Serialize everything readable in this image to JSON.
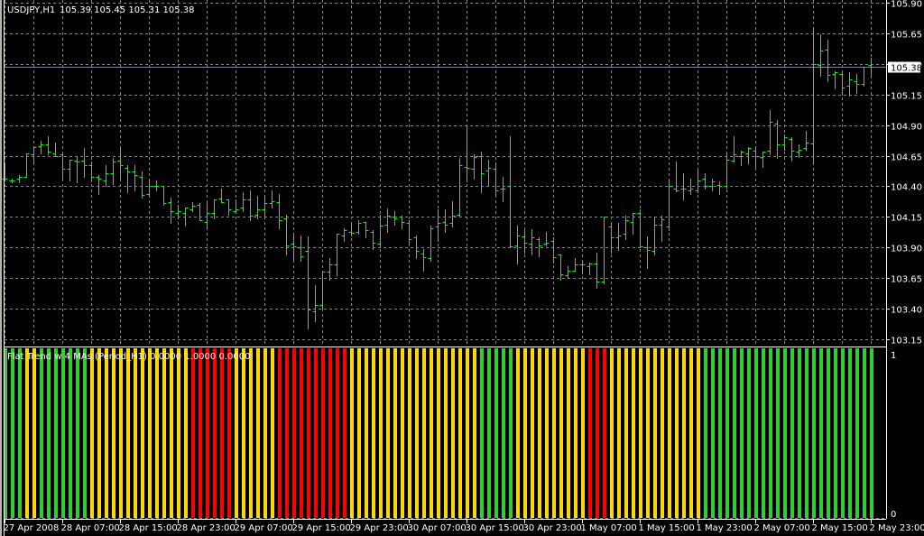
{
  "header": {
    "symbol": "USDJPY,H1",
    "ohlc": "105.39 105.45 105.31 105.38"
  },
  "indicator": {
    "label": "Flat Trend w 4 MAs (Period_H1) 0.0000 1.0000 0.0000",
    "axis_top": "1",
    "axis_bottom": "0"
  },
  "colors": {
    "background": "#000000",
    "bar": "#00ff00",
    "grid": "#778899",
    "green": "#32cd32",
    "yellow": "#ffd700",
    "red": "#ff0000"
  },
  "chart_data": [
    {
      "type": "ohlc",
      "title": "USDJPY,H1",
      "ylim": [
        103.15,
        105.9
      ],
      "y_ticks": [
        "105.90",
        "105.65",
        "105.40",
        "105.15",
        "104.90",
        "104.65",
        "104.40",
        "104.15",
        "103.90",
        "103.65",
        "103.40",
        "103.15"
      ],
      "current_price": "105.38",
      "x_ticks": [
        "27 Apr 2008",
        "28 Apr 07:00",
        "28 Apr 15:00",
        "28 Apr 23:00",
        "29 Apr 07:00",
        "29 Apr 15:00",
        "29 Apr 23:00",
        "30 Apr 07:00",
        "30 Apr 15:00",
        "30 Apr 23:00",
        "1 May 07:00",
        "1 May 15:00",
        "1 May 23:00",
        "2 May 07:00",
        "2 May 15:00",
        "2 May 23:00"
      ],
      "x_tick_every_bars": 8,
      "grid": true,
      "bars_ohlc": [
        [
          104.46,
          104.57,
          104.45,
          104.46
        ],
        [
          104.45,
          104.46,
          104.43,
          104.45
        ],
        [
          104.46,
          104.49,
          104.43,
          104.48
        ],
        [
          104.48,
          104.67,
          104.48,
          104.67
        ],
        [
          104.66,
          104.73,
          104.58,
          104.72
        ],
        [
          104.73,
          104.77,
          104.67,
          104.74
        ],
        [
          104.74,
          104.81,
          104.66,
          104.68
        ],
        [
          104.67,
          104.76,
          104.65,
          104.65
        ],
        [
          104.66,
          104.66,
          104.47,
          104.54
        ],
        [
          104.54,
          104.62,
          104.45,
          104.62
        ],
        [
          104.61,
          104.65,
          104.43,
          104.6
        ],
        [
          104.61,
          104.71,
          104.48,
          104.57
        ],
        [
          104.57,
          104.6,
          104.44,
          104.48
        ],
        [
          104.48,
          104.49,
          104.34,
          104.46
        ],
        [
          104.45,
          104.57,
          104.4,
          104.51
        ],
        [
          104.51,
          104.63,
          104.42,
          104.6
        ],
        [
          104.61,
          104.72,
          104.47,
          104.57
        ],
        [
          104.55,
          104.57,
          104.35,
          104.52
        ],
        [
          104.52,
          104.57,
          104.37,
          104.49
        ],
        [
          104.48,
          104.52,
          104.31,
          104.33
        ],
        [
          104.34,
          104.46,
          104.32,
          104.4
        ],
        [
          104.4,
          104.45,
          104.37,
          104.4
        ],
        [
          104.4,
          104.4,
          104.25,
          104.26
        ],
        [
          104.27,
          104.31,
          104.1,
          104.2
        ],
        [
          104.18,
          104.25,
          104.14,
          104.2
        ],
        [
          104.18,
          104.23,
          104.08,
          104.23
        ],
        [
          104.21,
          104.27,
          104.2,
          104.24
        ],
        [
          104.25,
          104.26,
          104.12,
          104.12
        ],
        [
          104.11,
          104.26,
          104.06,
          104.18
        ],
        [
          104.18,
          104.29,
          104.14,
          104.29
        ],
        [
          104.3,
          104.38,
          104.27,
          104.27
        ],
        [
          104.29,
          104.29,
          104.17,
          104.21
        ],
        [
          104.2,
          104.29,
          104.18,
          104.21
        ],
        [
          104.23,
          104.35,
          104.2,
          104.29
        ],
        [
          104.29,
          104.37,
          104.12,
          104.16
        ],
        [
          104.17,
          104.32,
          104.14,
          104.21
        ],
        [
          104.21,
          104.33,
          104.14,
          104.26
        ],
        [
          104.26,
          104.37,
          104.23,
          104.28
        ],
        [
          104.27,
          104.34,
          104.06,
          104.12
        ],
        [
          104.14,
          104.17,
          103.84,
          103.92
        ],
        [
          103.93,
          104.02,
          103.79,
          103.91
        ],
        [
          103.9,
          104.0,
          103.79,
          103.83
        ],
        [
          103.87,
          103.99,
          103.24,
          103.39
        ],
        [
          103.38,
          103.59,
          103.3,
          103.43
        ],
        [
          103.43,
          103.7,
          103.4,
          103.7
        ],
        [
          103.7,
          103.81,
          103.64,
          103.76
        ],
        [
          103.76,
          104.01,
          103.67,
          104.01
        ],
        [
          104.0,
          104.06,
          103.95,
          104.04
        ],
        [
          104.03,
          104.11,
          104.0,
          104.02
        ],
        [
          104.03,
          104.12,
          104.01,
          104.1
        ],
        [
          104.11,
          104.11,
          103.98,
          104.04
        ],
        [
          104.03,
          104.04,
          103.89,
          103.94
        ],
        [
          103.93,
          104.17,
          103.9,
          104.08
        ],
        [
          104.09,
          104.22,
          104.03,
          104.16
        ],
        [
          104.15,
          104.2,
          104.09,
          104.14
        ],
        [
          104.15,
          104.16,
          104.06,
          104.11
        ],
        [
          104.1,
          104.12,
          103.93,
          103.97
        ],
        [
          103.98,
          104.0,
          103.81,
          103.87
        ],
        [
          103.85,
          103.89,
          103.71,
          103.82
        ],
        [
          103.81,
          104.08,
          103.79,
          104.06
        ],
        [
          104.07,
          104.21,
          103.95,
          104.1
        ],
        [
          104.11,
          104.21,
          104.03,
          104.09
        ],
        [
          104.1,
          104.28,
          104.07,
          104.16
        ],
        [
          104.17,
          104.63,
          104.15,
          104.57
        ],
        [
          104.56,
          104.9,
          104.44,
          104.55
        ],
        [
          104.54,
          104.66,
          104.46,
          104.64
        ],
        [
          104.65,
          104.68,
          104.35,
          104.51
        ],
        [
          104.53,
          104.62,
          104.41,
          104.55
        ],
        [
          104.54,
          104.59,
          104.33,
          104.37
        ],
        [
          104.38,
          104.48,
          104.28,
          104.38
        ],
        [
          104.4,
          104.81,
          103.9,
          103.91
        ],
        [
          103.92,
          104.08,
          103.77,
          104.0
        ],
        [
          103.99,
          104.05,
          103.86,
          103.94
        ],
        [
          103.93,
          104.05,
          103.84,
          103.98
        ],
        [
          103.97,
          103.98,
          103.83,
          103.92
        ],
        [
          103.93,
          104.03,
          103.92,
          103.94
        ],
        [
          103.95,
          103.98,
          103.78,
          103.82
        ],
        [
          103.84,
          103.84,
          103.64,
          103.68
        ],
        [
          103.67,
          103.75,
          103.66,
          103.71
        ],
        [
          103.71,
          103.81,
          103.71,
          103.76
        ],
        [
          103.76,
          103.8,
          103.69,
          103.76
        ],
        [
          103.75,
          103.78,
          103.68,
          103.77
        ],
        [
          103.77,
          103.86,
          103.57,
          103.62
        ],
        [
          103.62,
          104.15,
          103.61,
          104.15
        ],
        [
          104.07,
          104.11,
          103.86,
          103.98
        ],
        [
          103.98,
          104.1,
          103.88,
          104.0
        ],
        [
          104.01,
          104.16,
          103.97,
          104.12
        ],
        [
          104.11,
          104.18,
          104.01,
          104.18
        ],
        [
          104.18,
          104.21,
          103.9,
          103.91
        ],
        [
          103.9,
          103.99,
          103.73,
          103.88
        ],
        [
          103.87,
          104.15,
          103.84,
          104.09
        ],
        [
          104.09,
          104.16,
          103.95,
          104.13
        ],
        [
          104.07,
          104.46,
          104.04,
          104.4
        ],
        [
          104.38,
          104.6,
          104.36,
          104.37
        ],
        [
          104.38,
          104.51,
          104.29,
          104.38
        ],
        [
          104.37,
          104.46,
          104.34,
          104.38
        ],
        [
          104.37,
          104.55,
          104.35,
          104.45
        ],
        [
          104.46,
          104.51,
          104.38,
          104.4
        ],
        [
          104.4,
          104.46,
          104.37,
          104.44
        ],
        [
          104.41,
          104.44,
          104.34,
          104.4
        ],
        [
          104.4,
          104.66,
          104.39,
          104.62
        ],
        [
          104.61,
          104.81,
          104.6,
          104.66
        ],
        [
          104.65,
          104.69,
          104.57,
          104.68
        ],
        [
          104.67,
          104.72,
          104.59,
          104.71
        ],
        [
          104.69,
          104.73,
          104.56,
          104.65
        ],
        [
          104.64,
          104.68,
          104.56,
          104.68
        ],
        [
          104.69,
          105.02,
          104.66,
          104.93
        ],
        [
          104.91,
          104.94,
          104.63,
          104.74
        ],
        [
          104.74,
          104.82,
          104.7,
          104.8
        ],
        [
          104.79,
          104.8,
          104.61,
          104.69
        ],
        [
          104.68,
          104.74,
          104.64,
          104.7
        ],
        [
          104.71,
          104.85,
          104.7,
          104.76
        ],
        [
          104.75,
          105.7,
          104.6,
          105.4
        ],
        [
          105.39,
          105.64,
          105.3,
          105.51
        ],
        [
          105.52,
          105.6,
          105.26,
          105.31
        ],
        [
          105.32,
          105.34,
          105.2,
          105.33
        ],
        [
          105.32,
          105.33,
          105.15,
          105.21
        ],
        [
          105.22,
          105.33,
          105.14,
          105.27
        ],
        [
          105.26,
          105.32,
          105.16,
          105.24
        ],
        [
          105.24,
          105.38,
          105.22,
          105.38
        ],
        [
          105.39,
          105.45,
          105.31,
          105.38
        ]
      ]
    },
    {
      "type": "bar",
      "title": "Flat Trend w 4 MAs (Period_H1)",
      "ylim": [
        0,
        1
      ],
      "values_all": 1,
      "state_legend": {
        "G": "green",
        "Y": "yellow",
        "R": "red"
      },
      "states": "GGGYYGGGGGGGYYYYYYYYYYYYYYRRRRRRYYYYYYRRRRRRRRRRYYYYYYYYYYYYYYYYYYGGGGGYYYYYYYYYYRRRYYYYYYYYYYYYYGGGGGGGGGGGGGGGGGGGGGGGG"
    }
  ]
}
